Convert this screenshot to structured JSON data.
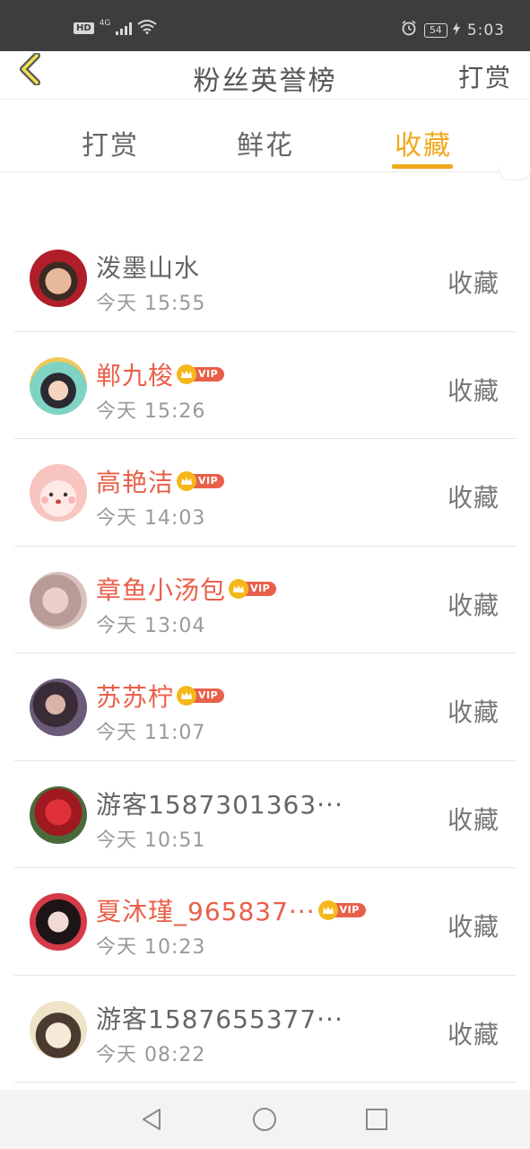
{
  "status_bar": {
    "hd": "HD",
    "network": "4G",
    "battery": "54",
    "time": "5:03"
  },
  "nav": {
    "title": "粉丝英誉榜",
    "action_label": "打赏"
  },
  "tabs": [
    {
      "label": "打赏",
      "active": false
    },
    {
      "label": "鲜花",
      "active": false
    },
    {
      "label": "收藏",
      "active": true
    }
  ],
  "accent_color": "#f0a81c",
  "vip_label": "VIP",
  "fans": [
    {
      "name": "泼墨山水",
      "time": "今天 15:55",
      "vip": false,
      "action": "收藏"
    },
    {
      "name": "郸九梭",
      "time": "今天 15:26",
      "vip": true,
      "action": "收藏"
    },
    {
      "name": "高艳洁",
      "time": "今天 14:03",
      "vip": true,
      "action": "收藏"
    },
    {
      "name": "章鱼小汤包",
      "time": "今天 13:04",
      "vip": true,
      "action": "收藏"
    },
    {
      "name": "苏苏柠",
      "time": "今天 11:07",
      "vip": true,
      "action": "收藏"
    },
    {
      "name": "游客1587301363···",
      "time": "今天 10:51",
      "vip": false,
      "action": "收藏"
    },
    {
      "name": "夏沐瑾_965837···",
      "time": "今天 10:23",
      "vip": true,
      "action": "收藏"
    },
    {
      "name": "游客1587655377···",
      "time": "今天 08:22",
      "vip": false,
      "action": "收藏"
    }
  ]
}
